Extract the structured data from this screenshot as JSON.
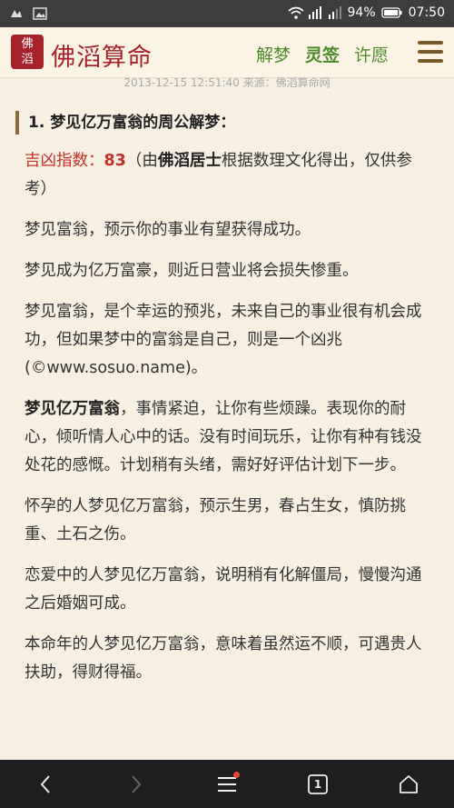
{
  "status_bar": {
    "battery": "94%",
    "time": "07:50"
  },
  "header": {
    "logo_seal_top": "佛",
    "logo_seal_bottom": "滔",
    "logo_text": "佛滔算命",
    "nav": [
      "解梦",
      "灵签",
      "许愿"
    ]
  },
  "meta": {
    "line": "2013-12-15 12:51:40  来源：佛滔算命网"
  },
  "article": {
    "section_title": "1. 梦见亿万富翁的周公解梦：",
    "score_label": "吉凶指数：",
    "score_value": "83",
    "score_note_prefix": "（由",
    "score_note_bold": "佛滔居士",
    "score_note_suffix": "根据数理文化得出，仅供参考）",
    "p1": "梦见富翁，预示你的事业有望获得成功。",
    "p2": "梦见成为亿万富豪，则近日营业将会损失惨重。",
    "p3": "梦见富翁，是个幸运的预兆，未来自己的事业很有机会成功，但如果梦中的富翁是自己，则是一个凶兆(©www.sosuo.name)。",
    "p4_bold": "梦见亿万富翁",
    "p4_rest": "，事情紧迫，让你有些烦躁。表现你的耐心，倾听情人心中的话。没有时间玩乐，让你有种有钱没处花的感慨。计划稍有头绪，需好好评估计划下一步。",
    "p5": "怀孕的人梦见亿万富翁，预示生男，春占生女，慎防挑重、土石之伤。",
    "p6": "恋爱中的人梦见亿万富翁，说明稍有化解僵局，慢慢沟通之后婚姻可成。",
    "p7": "本命年的人梦见亿万富翁，意味着虽然运不顺，可遇贵人扶助，得财得福。"
  },
  "bottom_bar": {
    "tab_count": "1"
  },
  "colors": {
    "accent_red": "#a6232b",
    "nav_green": "#4e8a2c",
    "score_red": "#c4302b"
  }
}
